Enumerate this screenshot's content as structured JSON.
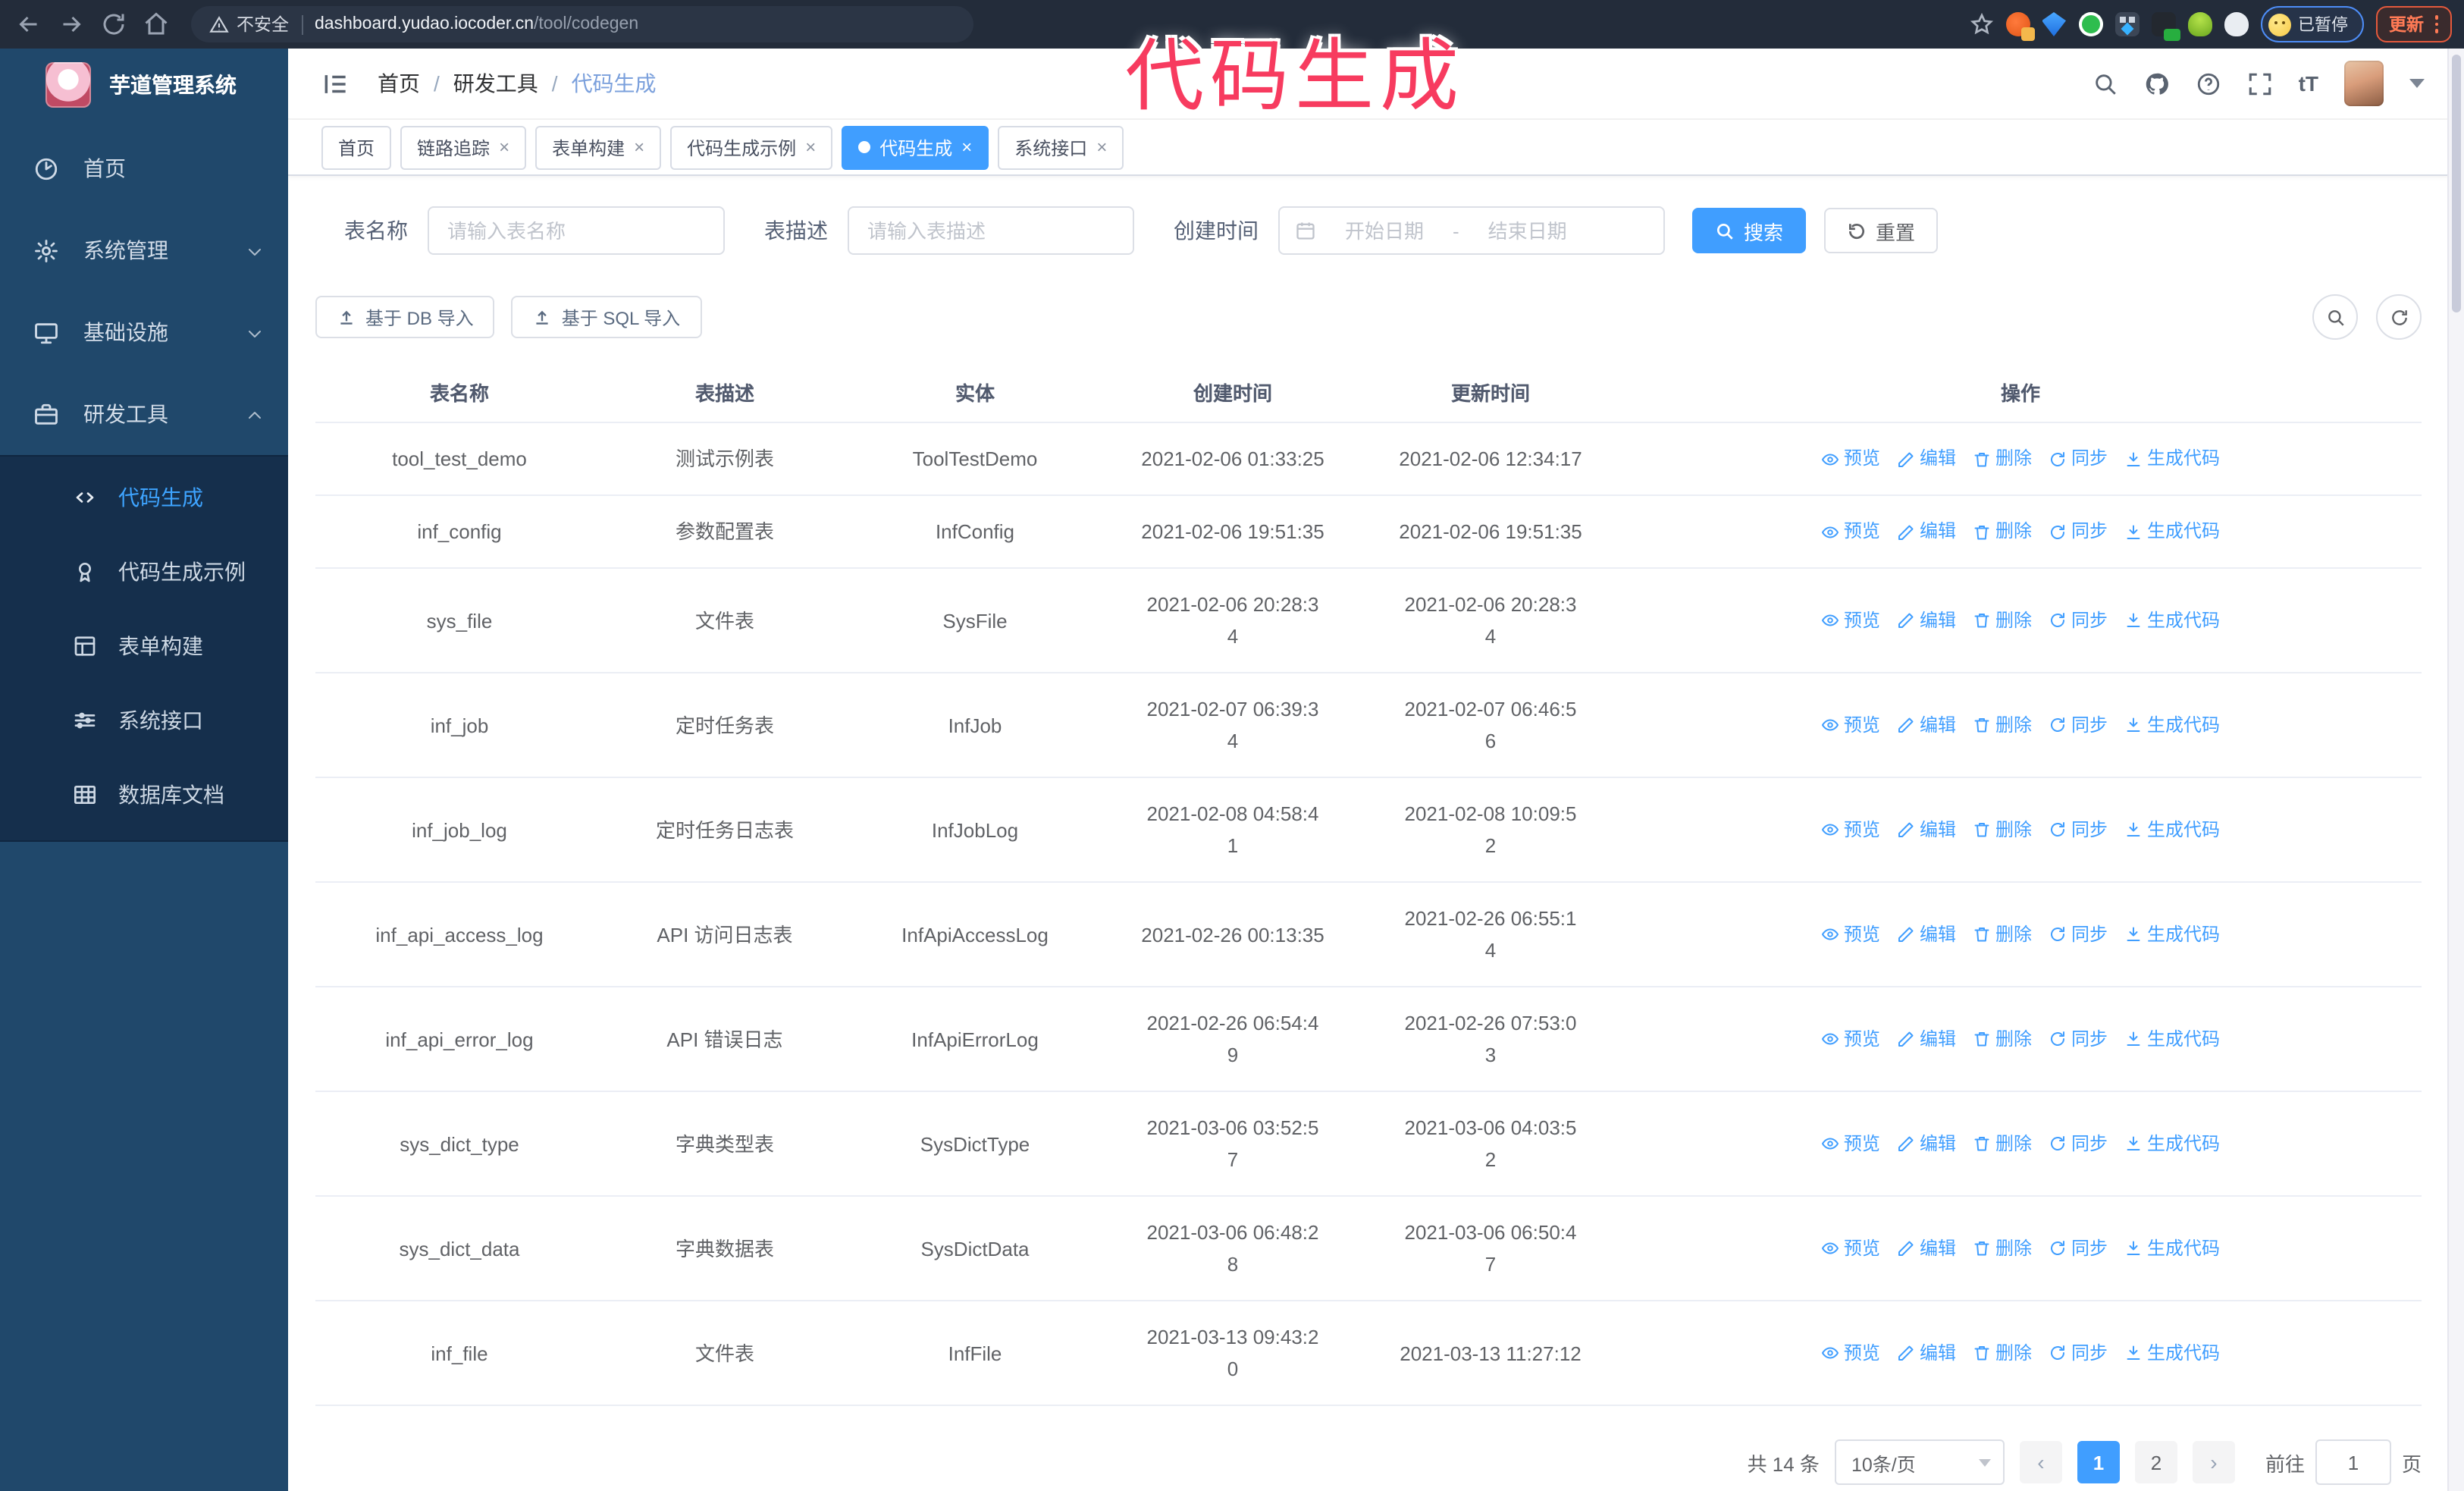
{
  "colors": {
    "accent": "#409eff",
    "sidebar_bg": "#20486b",
    "submenu_bg": "#152f4c",
    "annotation_pink": "#f73b5f",
    "browser_bar": "#232c3a"
  },
  "browser": {
    "security_label": "不安全",
    "url_host": "dashboard.yudao.iocoder.cn",
    "url_path": "/tool/codegen",
    "paused_badge": "已暂停",
    "update_button": "更新"
  },
  "annotation": {
    "text": "代码生成"
  },
  "sidebar": {
    "app_title": "芋道管理系统",
    "items": [
      {
        "label": "首页",
        "icon": "dashboard",
        "type": "item"
      },
      {
        "label": "系统管理",
        "icon": "gear",
        "type": "group",
        "chevron": "down"
      },
      {
        "label": "基础设施",
        "icon": "infra",
        "type": "group",
        "chevron": "down"
      },
      {
        "label": "研发工具",
        "icon": "briefcase",
        "type": "group",
        "chevron": "up"
      }
    ],
    "submenu": [
      {
        "label": "代码生成",
        "icon": "code",
        "active": true
      },
      {
        "label": "代码生成示例",
        "icon": "example",
        "active": false
      },
      {
        "label": "表单构建",
        "icon": "form",
        "active": false
      },
      {
        "label": "系统接口",
        "icon": "api",
        "active": false
      },
      {
        "label": "数据库文档",
        "icon": "database",
        "active": false
      }
    ]
  },
  "header": {
    "breadcrumb": [
      "首页",
      "研发工具",
      "代码生成"
    ],
    "font_size_label": "tT"
  },
  "tabs": [
    {
      "label": "首页",
      "closable": false,
      "active": false
    },
    {
      "label": "链路追踪",
      "closable": true,
      "active": false
    },
    {
      "label": "表单构建",
      "closable": true,
      "active": false
    },
    {
      "label": "代码生成示例",
      "closable": true,
      "active": false
    },
    {
      "label": "代码生成",
      "closable": true,
      "active": true
    },
    {
      "label": "系统接口",
      "closable": true,
      "active": false
    }
  ],
  "filters": {
    "table_name_label": "表名称",
    "table_name_placeholder": "请输入表名称",
    "table_desc_label": "表描述",
    "table_desc_placeholder": "请输入表描述",
    "create_time_label": "创建时间",
    "date_start_placeholder": "开始日期",
    "date_separator": "-",
    "date_end_placeholder": "结束日期",
    "search_label": "搜索",
    "reset_label": "重置"
  },
  "toolbar": {
    "import_db_label": "基于 DB 导入",
    "import_sql_label": "基于 SQL 导入"
  },
  "table": {
    "columns": [
      "表名称",
      "表描述",
      "实体",
      "创建时间",
      "更新时间",
      "操作"
    ],
    "actions": [
      "预览",
      "编辑",
      "删除",
      "同步",
      "生成代码"
    ],
    "rows": [
      {
        "name": "tool_test_demo",
        "desc": "测试示例表",
        "entity": "ToolTestDemo",
        "create": "2021-02-06 01:33:25",
        "update": "2021-02-06 12:34:17"
      },
      {
        "name": "inf_config",
        "desc": "参数配置表",
        "entity": "InfConfig",
        "create": "2021-02-06 19:51:35",
        "update": "2021-02-06 19:51:35"
      },
      {
        "name": "sys_file",
        "desc": "文件表",
        "entity": "SysFile",
        "create": "2021-02-06 20:28:3\n4",
        "update": "2021-02-06 20:28:3\n4"
      },
      {
        "name": "inf_job",
        "desc": "定时任务表",
        "entity": "InfJob",
        "create": "2021-02-07 06:39:3\n4",
        "update": "2021-02-07 06:46:5\n6"
      },
      {
        "name": "inf_job_log",
        "desc": "定时任务日志表",
        "entity": "InfJobLog",
        "create": "2021-02-08 04:58:4\n1",
        "update": "2021-02-08 10:09:5\n2"
      },
      {
        "name": "inf_api_access_log",
        "desc": "API 访问日志表",
        "entity": "InfApiAccessLog",
        "create": "2021-02-26 00:13:35",
        "update": "2021-02-26 06:55:1\n4"
      },
      {
        "name": "inf_api_error_log",
        "desc": "API 错误日志",
        "entity": "InfApiErrorLog",
        "create": "2021-02-26 06:54:4\n9",
        "update": "2021-02-26 07:53:0\n3"
      },
      {
        "name": "sys_dict_type",
        "desc": "字典类型表",
        "entity": "SysDictType",
        "create": "2021-03-06 03:52:5\n7",
        "update": "2021-03-06 04:03:5\n2"
      },
      {
        "name": "sys_dict_data",
        "desc": "字典数据表",
        "entity": "SysDictData",
        "create": "2021-03-06 06:48:2\n8",
        "update": "2021-03-06 06:50:4\n7"
      },
      {
        "name": "inf_file",
        "desc": "文件表",
        "entity": "InfFile",
        "create": "2021-03-13 09:43:2\n0",
        "update": "2021-03-13 11:27:12"
      }
    ]
  },
  "pagination": {
    "total_label": "共 14 条",
    "page_size": "10条/页",
    "prev": "‹",
    "next": "›",
    "pages": [
      "1",
      "2"
    ],
    "active_page": "1",
    "goto_label": "前往",
    "goto_value": "1",
    "goto_suffix": "页"
  }
}
